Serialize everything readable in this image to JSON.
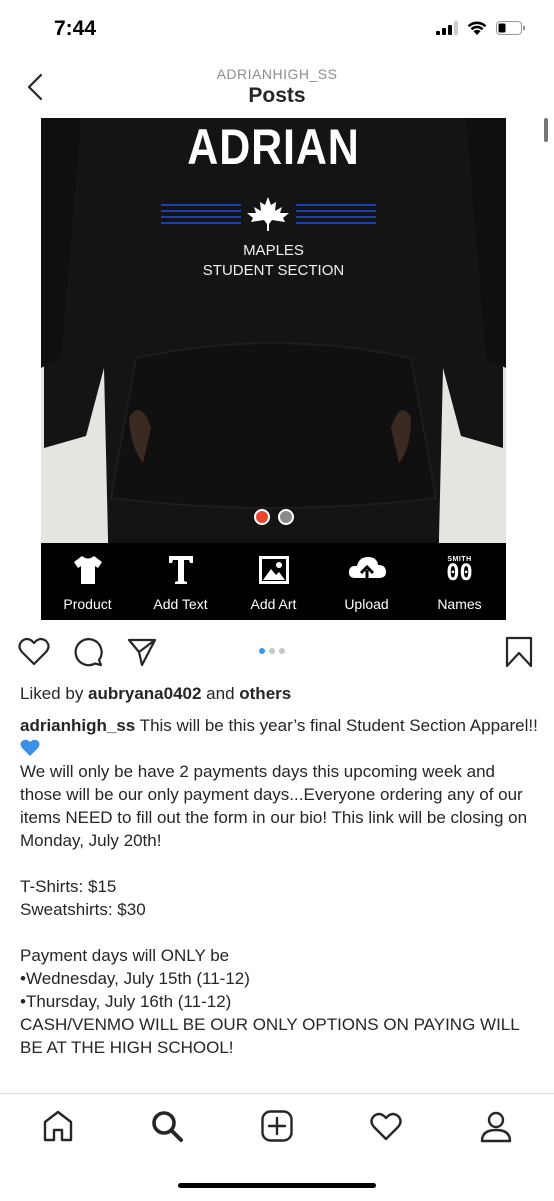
{
  "status_bar": {
    "time": "7:44"
  },
  "nav": {
    "account": "ADRIANHIGH_SS",
    "title": "Posts"
  },
  "media": {
    "brand_word": "ADRIAN",
    "brand_line1": "MAPLES",
    "brand_line2": "STUDENT SECTION",
    "image_carousel": {
      "count": 2,
      "active_index": 0,
      "active_color": "#e8442e",
      "inactive_color": "#8a8a8a"
    },
    "toolbar": [
      {
        "label": "Product",
        "icon": "tshirt-icon"
      },
      {
        "label": "Add Text",
        "icon": "text-icon"
      },
      {
        "label": "Add Art",
        "icon": "image-icon"
      },
      {
        "label": "Upload",
        "icon": "cloud-upload-icon"
      },
      {
        "label": "Names",
        "icon": "jersey-number-icon",
        "small": "SMITH",
        "big": "00"
      }
    ]
  },
  "post": {
    "carousel_count": 3,
    "carousel_active": 0,
    "likes_prefix": "Liked by ",
    "likes_user": "aubryana0402",
    "likes_middle": " and ",
    "likes_suffix": "others",
    "caption_user": "adrianhigh_ss",
    "caption_first": " This will be this year’s final Student Section Apparel!! ",
    "caption_body": "\nWe will only be have 2 payments days this upcoming week and those will be our only payment days...Everyone ordering any of our items NEED to fill out the form in our bio! This link will be closing on Monday, July 20th!\n\nT-Shirts: $15\nSweatshirts: $30\n\nPayment days will ONLY be\n•Wednesday, July 15th (11-12)\n•Thursday, July 16th (11-12)\nCASH/VENMO WILL BE OUR ONLY OPTIONS ON PAYING WILL BE AT THE HIGH SCHOOL!"
  },
  "bottom_nav": [
    "home-icon",
    "search-icon",
    "new-post-icon",
    "activity-heart-icon",
    "profile-icon"
  ],
  "colors": {
    "accent": "#3897f0",
    "heart_emoji": "#3b8fe6",
    "text": "#262626",
    "muted": "#8e8e8e"
  }
}
